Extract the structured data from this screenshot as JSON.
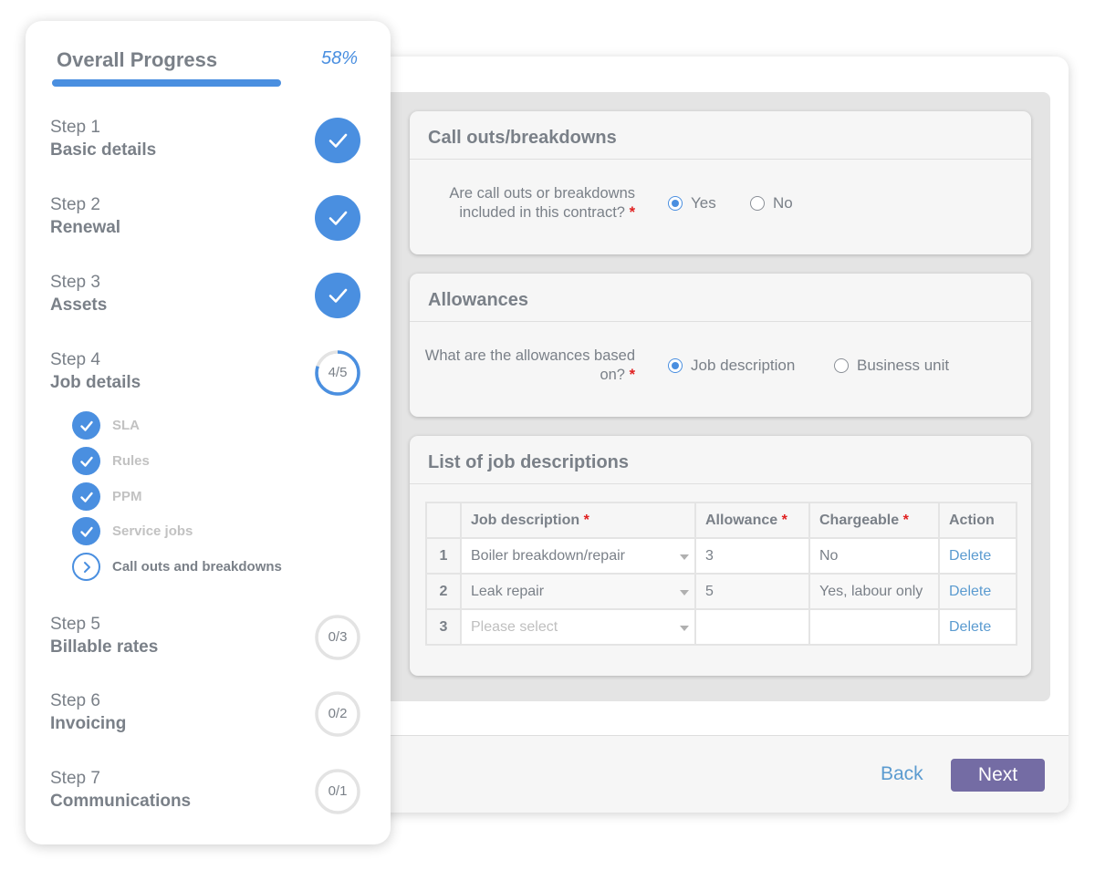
{
  "progress": {
    "title": "Overall Progress",
    "percent_label": "58%",
    "percent": 58,
    "steps": [
      {
        "num": "Step 1",
        "name": "Basic details",
        "status": "complete"
      },
      {
        "num": "Step 2",
        "name": "Renewal",
        "status": "complete"
      },
      {
        "num": "Step 3",
        "name": "Assets",
        "status": "complete"
      },
      {
        "num": "Step 4",
        "name": "Job details",
        "status": "in-progress",
        "count_label": "4/5",
        "done": 4,
        "total": 5
      },
      {
        "num": "Step 5",
        "name": "Billable rates",
        "status": "pending",
        "count_label": "0/3",
        "done": 0,
        "total": 3
      },
      {
        "num": "Step 6",
        "name": "Invoicing",
        "status": "pending",
        "count_label": "0/2",
        "done": 0,
        "total": 2
      },
      {
        "num": "Step 7",
        "name": "Communications",
        "status": "pending",
        "count_label": "0/1",
        "done": 0,
        "total": 1
      }
    ],
    "substeps": [
      {
        "label": "SLA",
        "status": "complete"
      },
      {
        "label": "Rules",
        "status": "complete"
      },
      {
        "label": "PPM",
        "status": "complete"
      },
      {
        "label": "Service jobs",
        "status": "complete"
      },
      {
        "label": "Call outs and breakdowns",
        "status": "current"
      }
    ]
  },
  "callouts": {
    "title": "Call outs/breakdowns",
    "question": "Are call outs or breakdowns included in this contract?",
    "required_mark": "*",
    "options": [
      {
        "label": "Yes",
        "checked": true
      },
      {
        "label": "No",
        "checked": false
      }
    ]
  },
  "allowances": {
    "title": "Allowances",
    "question": "What are the allowances based on?",
    "required_mark": "*",
    "options": [
      {
        "label": "Job description",
        "checked": true
      },
      {
        "label": "Business unit",
        "checked": false
      }
    ]
  },
  "job_list": {
    "title": "List of job descriptions",
    "columns": [
      {
        "label": "Job description",
        "required": "*"
      },
      {
        "label": "Allowance",
        "required": "*"
      },
      {
        "label": "Chargeable",
        "required": "*"
      },
      {
        "label": "Action",
        "required": ""
      }
    ],
    "rows": [
      {
        "num": "1",
        "job": "Boiler breakdown/repair",
        "allowance": "3",
        "chargeable": "No",
        "action": "Delete"
      },
      {
        "num": "2",
        "job": "Leak repair",
        "allowance": "5",
        "chargeable": "Yes, labour only",
        "action": "Delete"
      },
      {
        "num": "3",
        "job": "",
        "job_placeholder": "Please select",
        "allowance": "",
        "chargeable": "",
        "action": "Delete"
      }
    ]
  },
  "footer": {
    "back_label": "Back",
    "next_label": "Next"
  },
  "colors": {
    "accent": "#4a8fe0",
    "next_button": "#746ca4",
    "link": "#5b9bd0",
    "required": "#e02020"
  }
}
